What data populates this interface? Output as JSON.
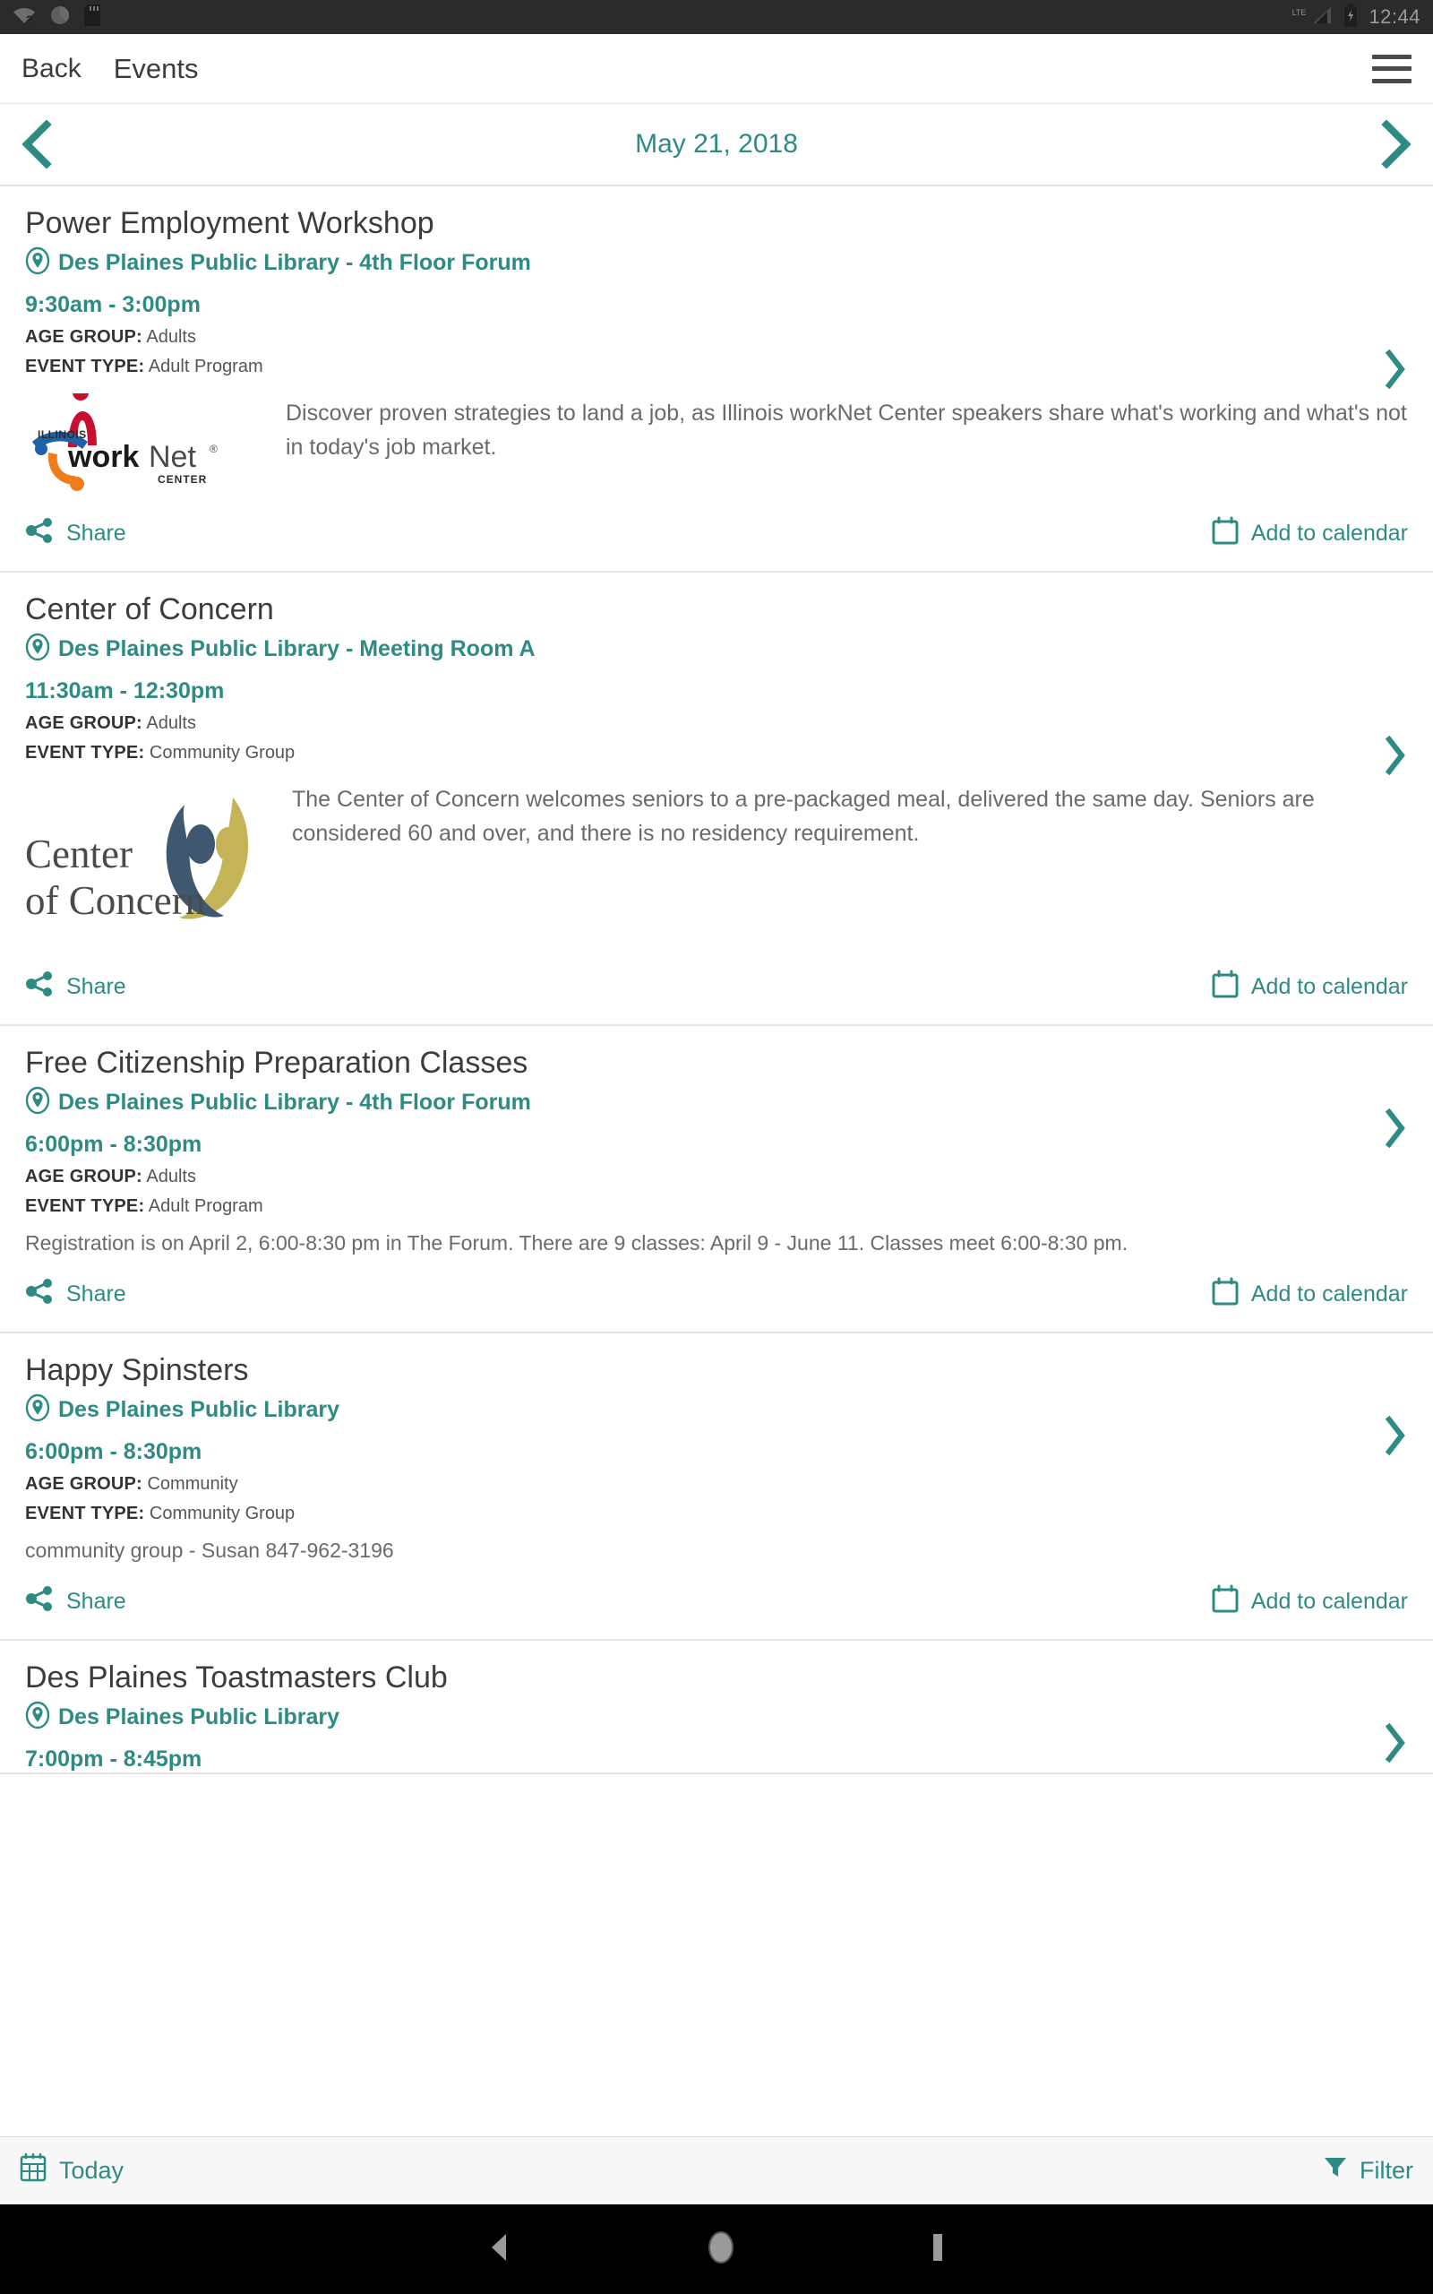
{
  "statusbar": {
    "time": "12:44",
    "network_label": "LTE",
    "icons": [
      "wifi-question-icon",
      "circle-icon",
      "sd-card-icon",
      "signal-icon",
      "battery-charging-icon"
    ]
  },
  "appbar": {
    "back_label": "Back",
    "title": "Events",
    "menu_icon": "hamburger-menu-icon"
  },
  "datenav": {
    "prev_icon": "chevron-left-icon",
    "date": "May 21, 2018",
    "next_icon": "chevron-right-icon"
  },
  "labels": {
    "age_group": "AGE GROUP:",
    "event_type": "EVENT TYPE:",
    "share": "Share",
    "add_to_calendar": "Add to calendar"
  },
  "colors": {
    "accent_teal": "#2e8b83",
    "title_gray": "#3c3c3c",
    "body_gray": "#6a6a6a",
    "statusbar_bg": "#2b2b2b",
    "bottombar_bg": "#f7f7f7"
  },
  "events": [
    {
      "title": "Power Employment Workshop",
      "location": "Des Plaines Public Library - 4th Floor Forum",
      "time": "9:30am - 3:00pm",
      "age_group": "Adults",
      "event_type": "Adult Program",
      "description": "Discover proven strategies to land a job, as Illinois workNet Center speakers share what's working and what's not in today's job market.",
      "logo": "illinois-worknet-center-logo"
    },
    {
      "title": "Center of Concern",
      "location": "Des Plaines Public Library - Meeting Room A",
      "time": "11:30am - 12:30pm",
      "age_group": "Adults",
      "event_type": "Community Group",
      "description": "The Center of Concern welcomes seniors to a pre-packaged meal, delivered the same day. Seniors are considered 60 and over, and there is no residency requirement.",
      "logo": "center-of-concern-logo"
    },
    {
      "title": "Free Citizenship Preparation Classes",
      "location": "Des Plaines Public Library - 4th Floor Forum",
      "time": "6:00pm - 8:30pm",
      "age_group": "Adults",
      "event_type": "Adult Program",
      "description": "Registration is on April 2, 6:00-8:30 pm in The Forum. There are 9 classes: April 9 - June 11. Classes meet 6:00-8:30 pm.",
      "logo": null
    },
    {
      "title": "Happy Spinsters",
      "location": "Des Plaines Public Library",
      "time": "6:00pm - 8:30pm",
      "age_group": "Community",
      "event_type": "Community Group",
      "description": "community group - Susan 847-962-3196",
      "logo": null
    },
    {
      "title": "Des Plaines Toastmasters Club",
      "location": "Des Plaines Public Library",
      "time": "7:00pm - 8:45pm",
      "age_group": null,
      "event_type": null,
      "description": null,
      "logo": null
    }
  ],
  "bottombar": {
    "today_label": "Today",
    "today_icon": "calendar-icon",
    "filter_label": "Filter",
    "filter_icon": "funnel-icon"
  },
  "navbar": {
    "back_icon": "triangle-back-icon",
    "home_icon": "circle-home-icon",
    "recents_icon": "square-recents-icon"
  },
  "logos": {
    "worknet": {
      "illinois": "ILLINOIS",
      "work": "work",
      "net": "Net",
      "center": "CENTER"
    },
    "center_of_concern": {
      "line1": "Center",
      "line2": "of Concern"
    }
  }
}
